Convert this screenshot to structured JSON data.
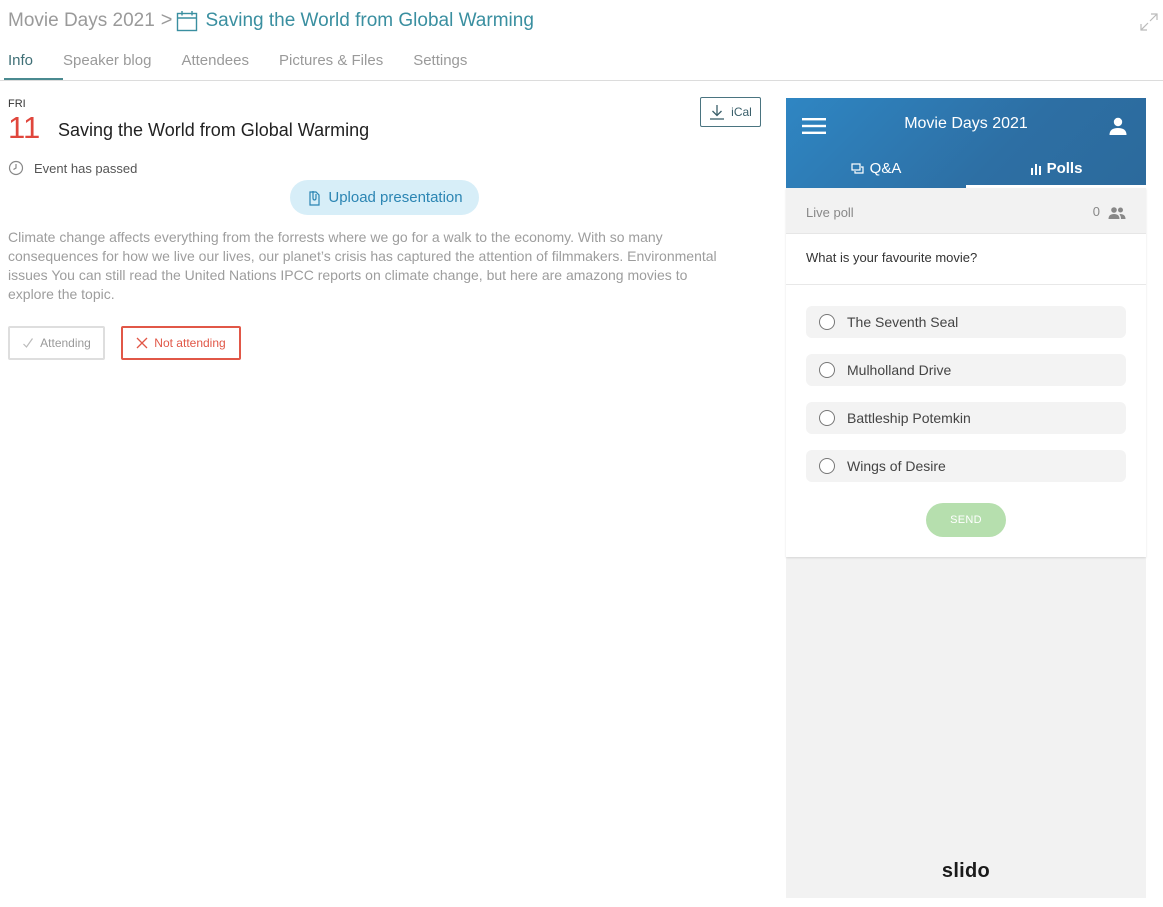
{
  "breadcrumb": {
    "parent": "Movie Days 2021",
    "separator": ">",
    "current": "Saving the World from Global Warming",
    "calendar_icon": "calendar-icon",
    "expand_icon": "expand-icon"
  },
  "tabs": [
    {
      "label": "Info",
      "active": true
    },
    {
      "label": "Speaker blog"
    },
    {
      "label": "Attendees"
    },
    {
      "label": "Pictures & Files"
    },
    {
      "label": "Settings"
    }
  ],
  "event": {
    "day_name": "FRI",
    "day_number": "11",
    "title": "Saving the World from Global Warming",
    "status": "Event has passed",
    "ical_label": "iCal",
    "upload_label": "Upload presentation",
    "description": "Climate change affects everything from the forrests where we go for a walk to the economy. With so many consequences for how we live our lives, our planet’s crisis has captured the attention of filmmakers. Environmental issues You can still read the United Nations IPCC reports on climate change, but here are amazong movies to explore the topic.",
    "attending_label": "Attending",
    "not_attending_label": "Not attending"
  },
  "slido": {
    "title": "Movie Days 2021",
    "tabs": {
      "qa": "Q&A",
      "polls": "Polls"
    },
    "live_label": "Live poll",
    "live_count": "0",
    "question": "What is your favourite movie?",
    "options": [
      "The Seventh Seal",
      "Mulholland Drive",
      "Battleship Potemkin",
      "Wings of Desire"
    ],
    "send_label": "SEND",
    "logo": "slido"
  },
  "colors": {
    "accent": "#3a8fa0",
    "day_red": "#e0463c",
    "not_attending_red": "#e15747",
    "slido_blue": "#2d6fa4",
    "send_green": "#b6dfae"
  }
}
